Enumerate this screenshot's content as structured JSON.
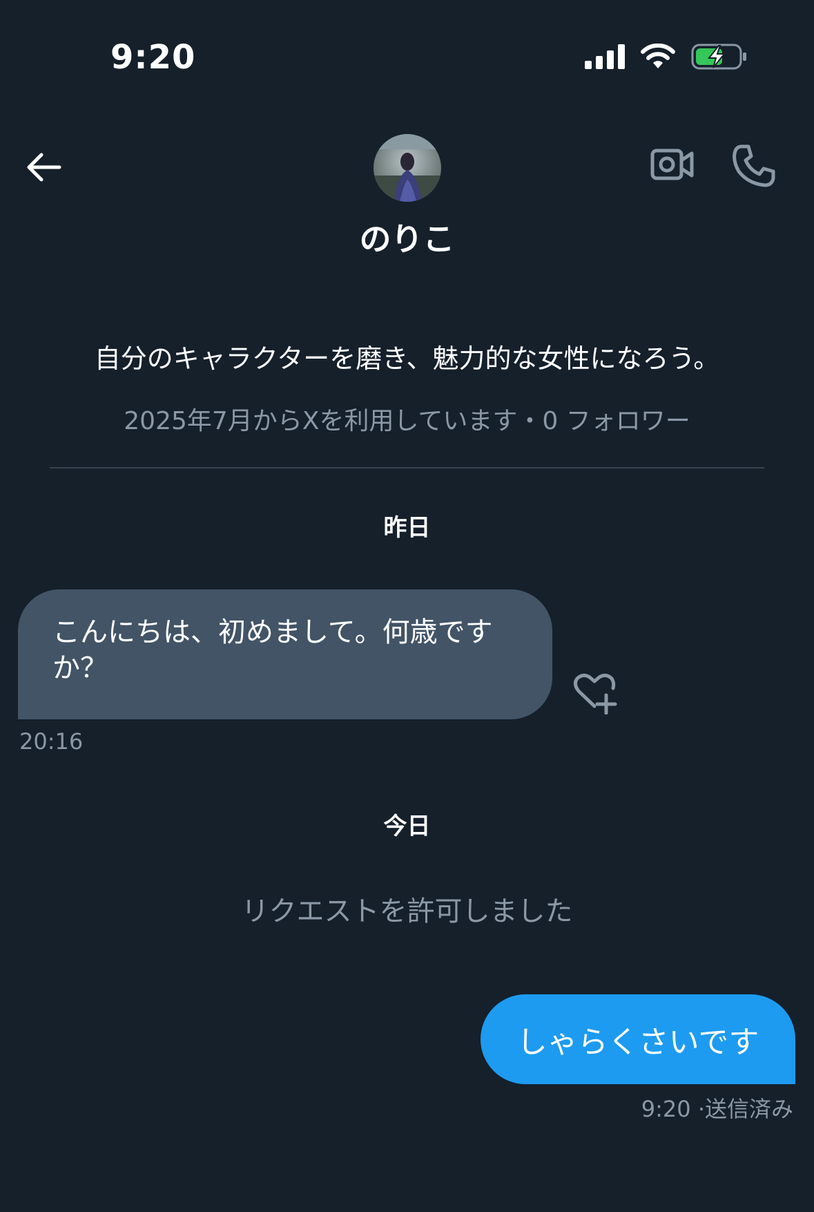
{
  "status_bar": {
    "time": "9:20"
  },
  "header": {
    "contact_name": "のりこ",
    "icons": {
      "back": "back-arrow-icon",
      "video": "video-call-icon",
      "phone": "phone-call-icon"
    }
  },
  "profile": {
    "bio": "自分のキャラクターを磨き、魅力的な女性になろう。",
    "meta": "2025年7月からXを利用しています・0 フォロワー"
  },
  "conversation": {
    "day_yesterday": "昨日",
    "incoming_message": "こんにちは、初めまして。何歳ですか？",
    "incoming_time": "20:16",
    "day_today": "今日",
    "system_message": "リクエストを許可しました",
    "outgoing_message": "しゃらくさいです",
    "outgoing_time": "9:20",
    "outgoing_status": "·送信済み"
  },
  "colors": {
    "background": "#15202b",
    "incoming_bubble": "#425466",
    "outgoing_bubble": "#1d9bf0",
    "muted_text": "#8b98a5",
    "battery_green": "#34c759"
  }
}
